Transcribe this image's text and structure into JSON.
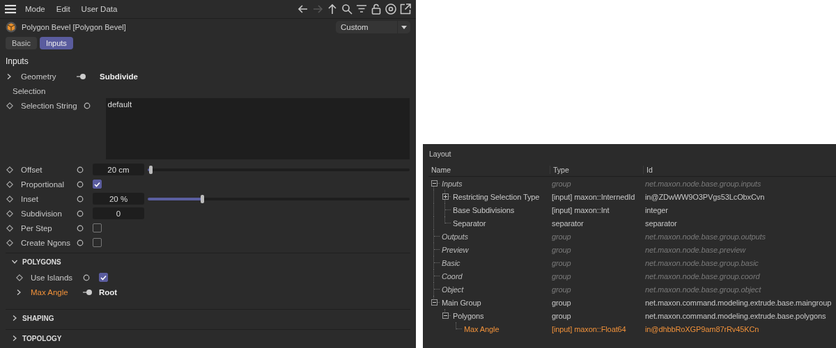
{
  "toolbar": {
    "menu": [
      "Mode",
      "Edit",
      "User Data"
    ]
  },
  "object": {
    "title": "Polygon Bevel [Polygon Bevel]",
    "preset": "Custom"
  },
  "tabs": [
    {
      "label": "Basic",
      "selected": false
    },
    {
      "label": "Inputs",
      "selected": true
    }
  ],
  "section_title": "Inputs",
  "params": [
    {
      "kind": "link",
      "label": "Geometry",
      "value": "Subdivide",
      "expanded": false,
      "highlighted": false
    },
    {
      "kind": "label",
      "label": "Selection",
      "highlighted": false
    },
    {
      "kind": "text_area",
      "label": "Selection String",
      "value": "default",
      "highlighted": false
    },
    {
      "kind": "slider",
      "label": "Offset",
      "value": "20 cm",
      "level": 0.013,
      "highlighted": false
    },
    {
      "kind": "checkbox",
      "label": "Proportional",
      "checked": true,
      "highlighted": false
    },
    {
      "kind": "slider",
      "label": "Inset",
      "value": "20 %",
      "level": 0.21,
      "highlighted": false
    },
    {
      "kind": "number",
      "label": "Subdivision",
      "value": "0",
      "highlighted": false
    },
    {
      "kind": "checkbox",
      "label": "Per Step",
      "checked": false,
      "highlighted": false
    },
    {
      "kind": "checkbox",
      "label": "Create Ngons",
      "checked": false,
      "highlighted": false
    }
  ],
  "groups": [
    {
      "title": "POLYGONS",
      "expanded": true,
      "params": [
        {
          "kind": "checkbox",
          "label": "Use Islands",
          "checked": true,
          "highlighted": false
        },
        {
          "kind": "link",
          "label": "Max Angle",
          "value": "Root",
          "expanded": false,
          "highlighted": true
        }
      ]
    },
    {
      "title": "SHAPING",
      "expanded": false
    },
    {
      "title": "TOPOLOGY",
      "expanded": false
    }
  ],
  "layout": {
    "title": "Layout",
    "columns": [
      "Name",
      "Type",
      "Id"
    ],
    "tree": [
      {
        "name": "Inputs",
        "type": "group",
        "id": "net.maxon.node.base.group.inputs",
        "inherited": true,
        "highlighted": false,
        "expanded": true,
        "children": [
          {
            "name": "Restricting Selection Type",
            "type": "[input] maxon::InternedId",
            "id": "in@ZDwWW9O3PVgs53LcObxCvn",
            "inherited": false,
            "highlighted": false,
            "expanded": false
          },
          {
            "name": "Base Subdivisions",
            "type": "[input] maxon::Int",
            "id": "integer",
            "inherited": false,
            "highlighted": false
          },
          {
            "name": "Separator",
            "type": "separator",
            "id": "separator",
            "inherited": false,
            "highlighted": false
          }
        ]
      },
      {
        "name": "Outputs",
        "type": "group",
        "id": "net.maxon.node.base.group.outputs",
        "inherited": true,
        "highlighted": false
      },
      {
        "name": "Preview",
        "type": "group",
        "id": "net.maxon.node.base.preview",
        "inherited": true,
        "highlighted": false
      },
      {
        "name": "Basic",
        "type": "group",
        "id": "net.maxon.node.base.group.basic",
        "inherited": true,
        "highlighted": false
      },
      {
        "name": "Coord",
        "type": "group",
        "id": "net.maxon.node.base.group.coord",
        "inherited": true,
        "highlighted": false
      },
      {
        "name": "Object",
        "type": "group",
        "id": "net.maxon.node.base.group.object",
        "inherited": true,
        "highlighted": false
      },
      {
        "name": "Main Group",
        "type": "group",
        "id": "net.maxon.command.modeling.extrude.base.maingroup",
        "inherited": false,
        "highlighted": false,
        "expanded": true,
        "children": [
          {
            "name": "Polygons",
            "type": "group",
            "id": "net.maxon.command.modeling.extrude.base.polygons",
            "inherited": false,
            "highlighted": false,
            "expanded": true,
            "children": [
              {
                "name": "Max Angle",
                "type": "[input] maxon::Float64",
                "id": "in@dhbbRoXGP9am87rRv45KCn",
                "inherited": false,
                "highlighted": true
              }
            ]
          }
        ]
      }
    ]
  }
}
